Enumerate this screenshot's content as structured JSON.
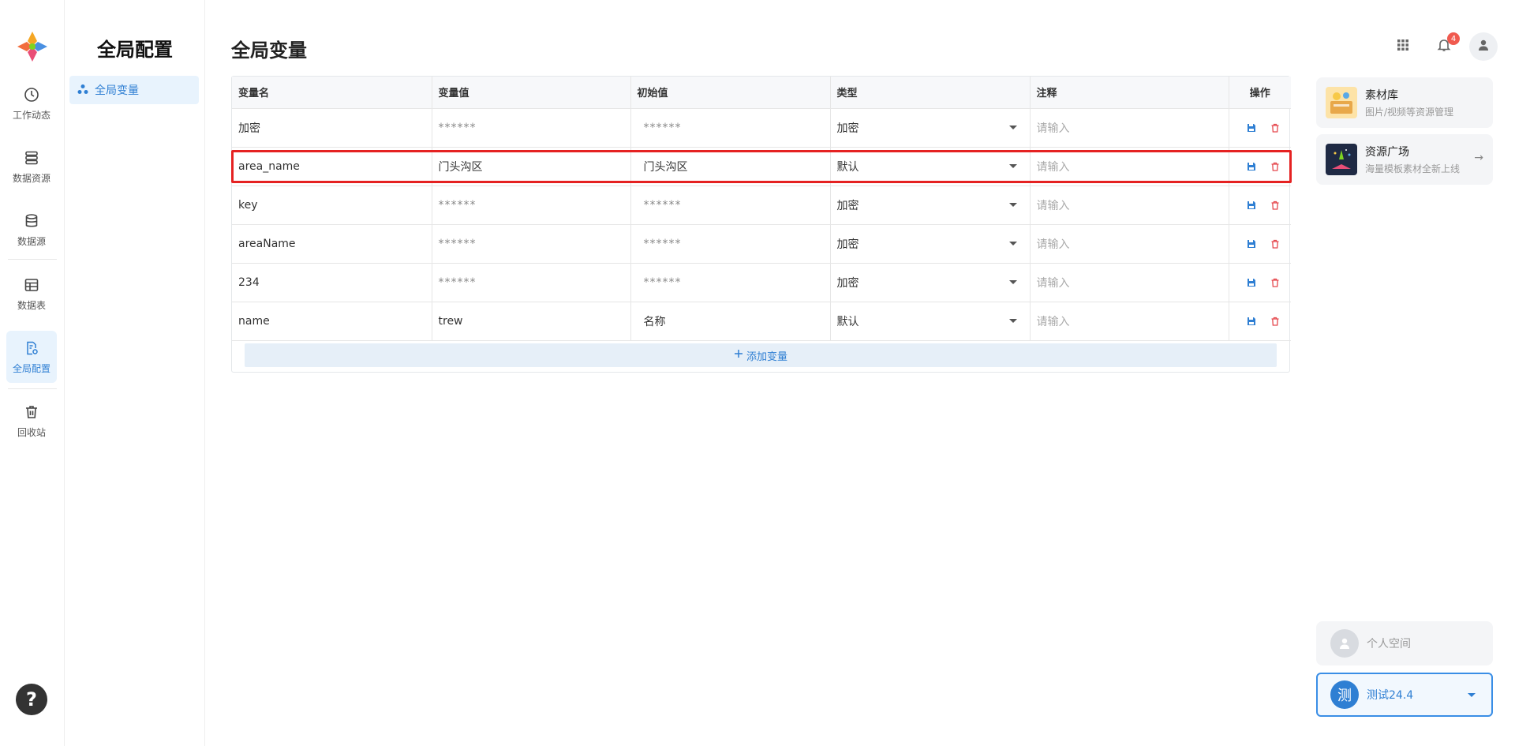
{
  "rail": {
    "items": [
      {
        "label": "工作动态",
        "icon": "clock-icon"
      },
      {
        "label": "数据资源",
        "icon": "server-stack-icon"
      },
      {
        "label": "数据源",
        "icon": "database-icon"
      },
      {
        "label": "数据表",
        "icon": "table-icon"
      },
      {
        "label": "全局配置",
        "icon": "config-file-icon",
        "active": true
      },
      {
        "label": "回收站",
        "icon": "trash-icon"
      }
    ],
    "help": "?"
  },
  "subnav": {
    "title": "全局配置",
    "items": [
      {
        "label": "全局变量",
        "icon": "nodes-icon",
        "active": true
      }
    ]
  },
  "main": {
    "title": "全局变量",
    "columns": [
      "变量名",
      "变量值",
      "初始值",
      "类型",
      "注释",
      "操作"
    ],
    "rows": [
      {
        "name": "加密",
        "value": "******",
        "initial": "******",
        "type": "加密",
        "note_placeholder": "请输入"
      },
      {
        "name": "area_name",
        "value": "门头沟区",
        "initial": "门头沟区",
        "type": "默认",
        "note_placeholder": "请输入",
        "highlighted": true
      },
      {
        "name": "key",
        "value": "******",
        "initial": "******",
        "type": "加密",
        "note_placeholder": "请输入"
      },
      {
        "name": "areaName",
        "value": "******",
        "initial": "******",
        "type": "加密",
        "note_placeholder": "请输入"
      },
      {
        "name": "234",
        "value": "******",
        "initial": "******",
        "type": "加密",
        "note_placeholder": "请输入"
      },
      {
        "name": "name",
        "value": "trew",
        "initial": "名称",
        "type": "默认",
        "note_placeholder": "请输入"
      }
    ],
    "add_label": "添加变量"
  },
  "header": {
    "notification_count": "4"
  },
  "right_panel": {
    "cards": [
      {
        "title": "素材库",
        "subtitle": "图片/视频等资源管理"
      },
      {
        "title": "资源广场",
        "subtitle": "海量模板素材全新上线"
      }
    ],
    "personal_space": "个人空间",
    "team": {
      "avatar": "测",
      "name": "测试24.4"
    }
  },
  "colors": {
    "accent": "#2f7fd3",
    "danger": "#e52222",
    "highlight_border": "#e52222"
  }
}
